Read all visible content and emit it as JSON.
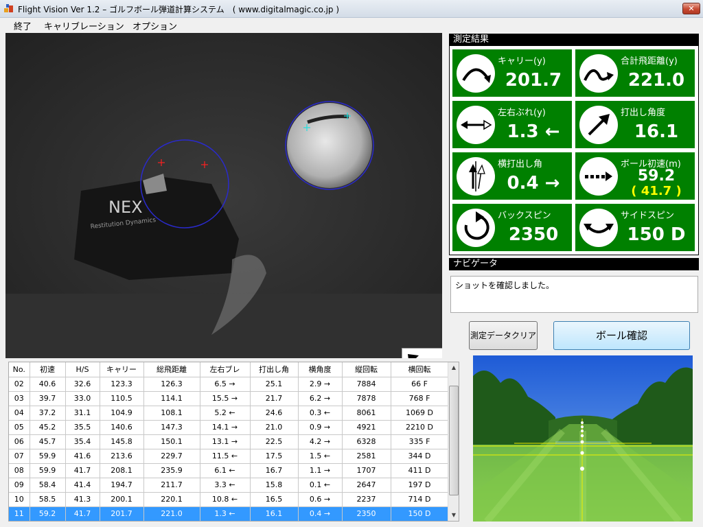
{
  "window": {
    "title": "Flight Vision  Ver 1.2 – ゴルフボール弾道計算システム　( www.digitalmagic.co.jp )",
    "close_label": "✕"
  },
  "menu": [
    "終了",
    "キャリブレーション",
    "オプション"
  ],
  "camera": {
    "brand_text": "NEX",
    "brand_subtext": "Restitution Dynamics"
  },
  "results": {
    "header": "測定結果",
    "tiles": [
      {
        "label": "キャリー(y)",
        "value": "201.7",
        "icon": "carry-arc-icon"
      },
      {
        "label": "合計飛距離(y)",
        "value": "221.0",
        "icon": "total-distance-icon"
      },
      {
        "label": "左右ぶれ(y)",
        "value": "1.3 ←",
        "icon": "lateral-offset-icon"
      },
      {
        "label": "打出し角度",
        "value": "16.1",
        "icon": "launch-angle-icon"
      },
      {
        "label": "横打出し角",
        "value": "0.4 →",
        "icon": "horizontal-launch-icon"
      },
      {
        "label": "ボール初速(m)",
        "value": "59.2",
        "sub": "( 41.7 )",
        "icon": "ball-speed-icon"
      },
      {
        "label": "バックスピン",
        "value": "2350",
        "icon": "backspin-icon"
      },
      {
        "label": "サイドスピン",
        "value": "150 D",
        "icon": "sidespin-icon"
      }
    ]
  },
  "navigator": {
    "header": "ナビゲータ",
    "message": "ショットを確認しました。"
  },
  "buttons": {
    "clear": "測定データクリア",
    "check": "ボール確認"
  },
  "table": {
    "headers": [
      "No.",
      "初速",
      "H/S",
      "キャリー",
      "総飛距離",
      "左右ブレ",
      "打出し角",
      "横角度",
      "縦回転",
      "横回転"
    ],
    "rows": [
      [
        "02",
        "40.6",
        "32.6",
        "123.3",
        "126.3",
        "6.5 →",
        "25.1",
        "2.9 →",
        "7884",
        "66 F"
      ],
      [
        "03",
        "39.7",
        "33.0",
        "110.5",
        "114.1",
        "15.5 →",
        "21.7",
        "6.2 →",
        "7878",
        "768 F"
      ],
      [
        "04",
        "37.2",
        "31.1",
        "104.9",
        "108.1",
        "5.2 ←",
        "24.6",
        "0.3 ←",
        "8061",
        "1069 D"
      ],
      [
        "05",
        "45.2",
        "35.5",
        "140.6",
        "147.3",
        "14.1 →",
        "21.0",
        "0.9 →",
        "4921",
        "2210 D"
      ],
      [
        "06",
        "45.7",
        "35.4",
        "145.8",
        "150.1",
        "13.1 →",
        "22.5",
        "4.2 →",
        "6328",
        "335 F"
      ],
      [
        "07",
        "59.9",
        "41.6",
        "213.6",
        "229.7",
        "11.5 ←",
        "17.5",
        "1.5 ←",
        "2581",
        "344 D"
      ],
      [
        "08",
        "59.9",
        "41.7",
        "208.1",
        "235.9",
        "6.1 ←",
        "16.7",
        "1.1 →",
        "1707",
        "411 D"
      ],
      [
        "09",
        "58.4",
        "41.4",
        "194.7",
        "211.7",
        "3.3 ←",
        "15.8",
        "0.1 ←",
        "2647",
        "197 D"
      ],
      [
        "10",
        "58.5",
        "41.3",
        "200.1",
        "220.1",
        "10.8 ←",
        "16.5",
        "0.6 →",
        "2237",
        "714 D"
      ],
      [
        "11",
        "59.2",
        "41.7",
        "201.7",
        "221.0",
        "1.3 ←",
        "16.1",
        "0.4 →",
        "2350",
        "150 D"
      ]
    ],
    "selected_row": 9
  },
  "colors": {
    "tile_green": "#008000",
    "selected_row": "#3399ff",
    "speed_sub": "#ffff00",
    "marker_red": "#ff2020",
    "marker_cyan": "#20e0e0",
    "circle_blue": "#2020c0"
  }
}
